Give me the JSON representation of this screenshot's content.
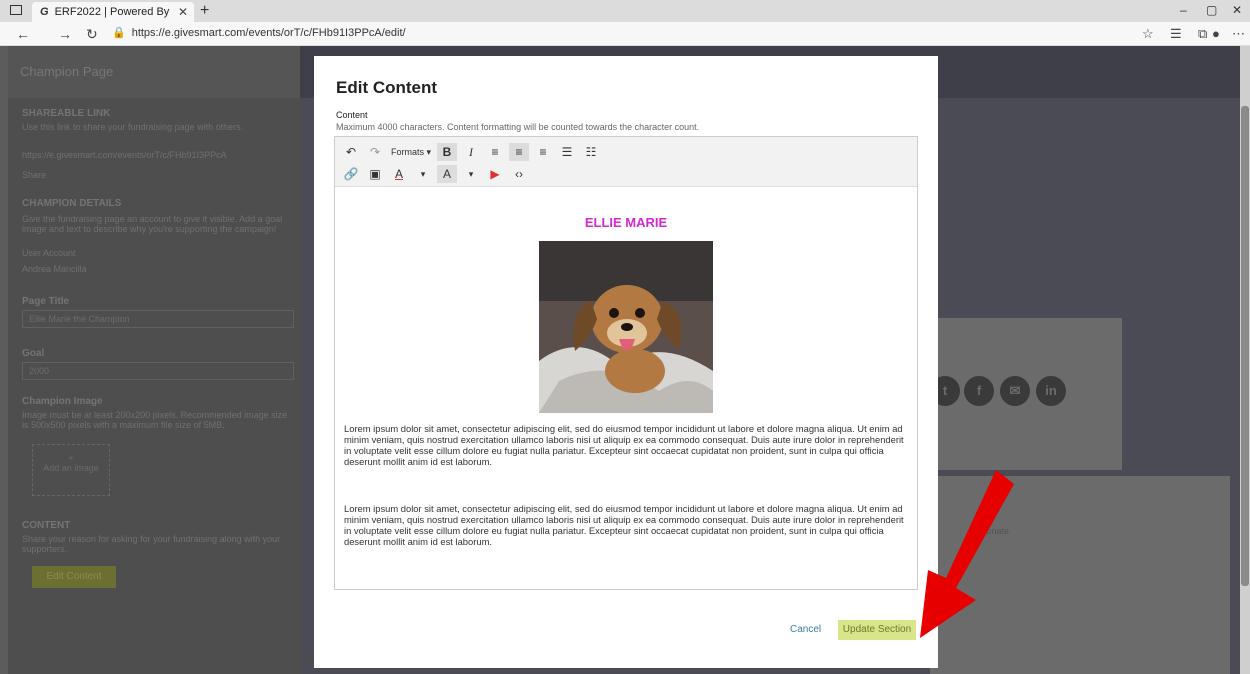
{
  "browser": {
    "tab_title": "ERF2022 | Powered By",
    "tab_favicon": "G",
    "new_tab": "+",
    "url": "https://e.givesmart.com/events/orT/c/FHb91I3PPcA/edit/"
  },
  "background_page": {
    "header": "Champion Page",
    "shareable_link_heading": "SHAREABLE LINK",
    "shareable_link_hint": "Use this link to share your fundraising page with others.",
    "shareable_link_value": "https://e.givesmart.com/events/orT/c/FHb91I3PPcA",
    "share_label": "Share",
    "champion_details_heading": "CHAMPION DETAILS",
    "champion_details_hint": "Give the fundraising page an account to give it visible. Add a goal image and text to describe why you're supporting the campaign!",
    "user_account_label": "User Account",
    "user_account_value": "Andrea Mancilla",
    "page_title_label": "Page Title",
    "page_title_value": "Ellie Marie the Champion",
    "goal_label": "Goal",
    "goal_value": "2000",
    "champion_image_label": "Champion Image",
    "champion_image_hint": "Image must be at least 200x200 pixels. Recommended image size is 500x500 pixels with a maximum file size of 5MB.",
    "add_image_label": "Add an image",
    "content_heading": "CONTENT",
    "content_hint": "Share your reason for asking for your fundraising along with your supporters.",
    "edit_content_button": "Edit Content",
    "right_text": "Donate"
  },
  "modal": {
    "title": "Edit Content",
    "content_label": "Content",
    "content_hint": "Maximum 4000 characters. Content formatting will be counted towards the character count.",
    "toolbar": {
      "undo": "↶",
      "redo": "↷",
      "formats": "Formats ▾",
      "bold": "B",
      "italic": "I",
      "align_left": "≡",
      "align_center": "≡",
      "align_right": "≡",
      "bullet_list": "☰",
      "numbered_list": "☷",
      "link": "🔗",
      "image": "▣",
      "text_color": "A",
      "bg_color": "A",
      "video": "▶",
      "source": "‹›"
    },
    "doc_title": "ELLIE MARIE",
    "paragraph_1": "Lorem ipsum dolor sit amet, consectetur adipiscing elit, sed do eiusmod tempor incididunt ut labore et dolore magna aliqua. Ut enim ad minim veniam, quis nostrud exercitation ullamco laboris nisi ut aliquip ex ea commodo consequat. Duis aute irure dolor in reprehenderit in voluptate velit esse cillum dolore eu fugiat nulla pariatur. Excepteur sint occaecat cupidatat non proident, sunt in culpa qui officia deserunt mollit anim id est laborum.",
    "paragraph_2": "Lorem ipsum dolor sit amet, consectetur adipiscing elit, sed do eiusmod tempor incididunt ut labore et dolore magna aliqua. Ut enim ad minim veniam, quis nostrud exercitation ullamco laboris nisi ut aliquip ex ea commodo consequat. Duis aute irure dolor in reprehenderit in voluptate velit esse cillum dolore eu fugiat nulla pariatur. Excepteur sint occaecat cupidatat non proident, sunt in culpa qui officia deserunt mollit anim id est laborum.",
    "cancel_label": "Cancel",
    "update_label": "Update Section"
  },
  "colors": {
    "title_magenta": "#d528d5",
    "update_button": "#d8e58a",
    "arrow_red": "#e60000"
  }
}
